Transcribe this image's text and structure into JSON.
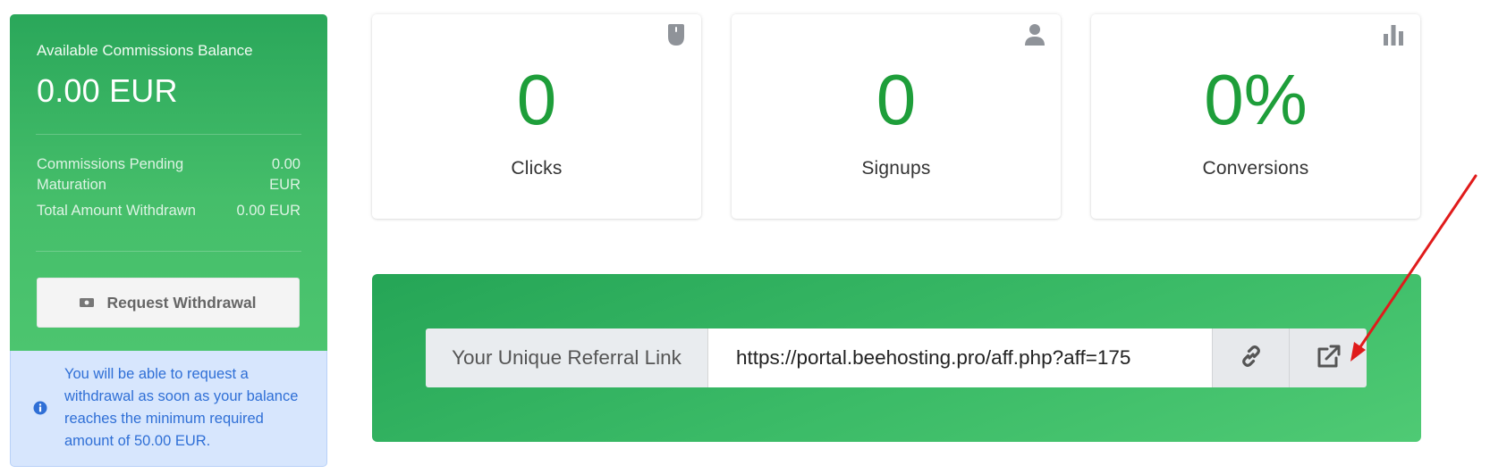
{
  "balance": {
    "label": "Available Commissions Balance",
    "amount": "0.00 EUR",
    "pending_label": "Commissions Pending Maturation",
    "pending_value": "0.00 EUR",
    "withdrawn_label": "Total Amount Withdrawn",
    "withdrawn_value": "0.00 EUR",
    "withdraw_button": "Request Withdrawal",
    "withdraw_icon": "money-bill-icon"
  },
  "notice": {
    "text": "You will be able to request a withdrawal as soon as your balance reaches the minimum required amount of 50.00 EUR.",
    "icon": "info-circle-icon"
  },
  "stats": [
    {
      "value": "0",
      "label": "Clicks",
      "icon": "mouse-icon"
    },
    {
      "value": "0",
      "label": "Signups",
      "icon": "user-icon"
    },
    {
      "value": "0%",
      "label": "Conversions",
      "icon": "bar-chart-icon"
    }
  ],
  "referral": {
    "label": "Your Unique Referral Link",
    "url": "https://portal.beehosting.pro/aff.php?aff=175",
    "copy_icon": "link-icon",
    "open_icon": "external-link-icon"
  },
  "colors": {
    "brand_green": "#2aa75a",
    "stat_green": "#1e9e3a",
    "notice_blue": "#2f6fd6",
    "annotation_red": "#e01b1b"
  }
}
